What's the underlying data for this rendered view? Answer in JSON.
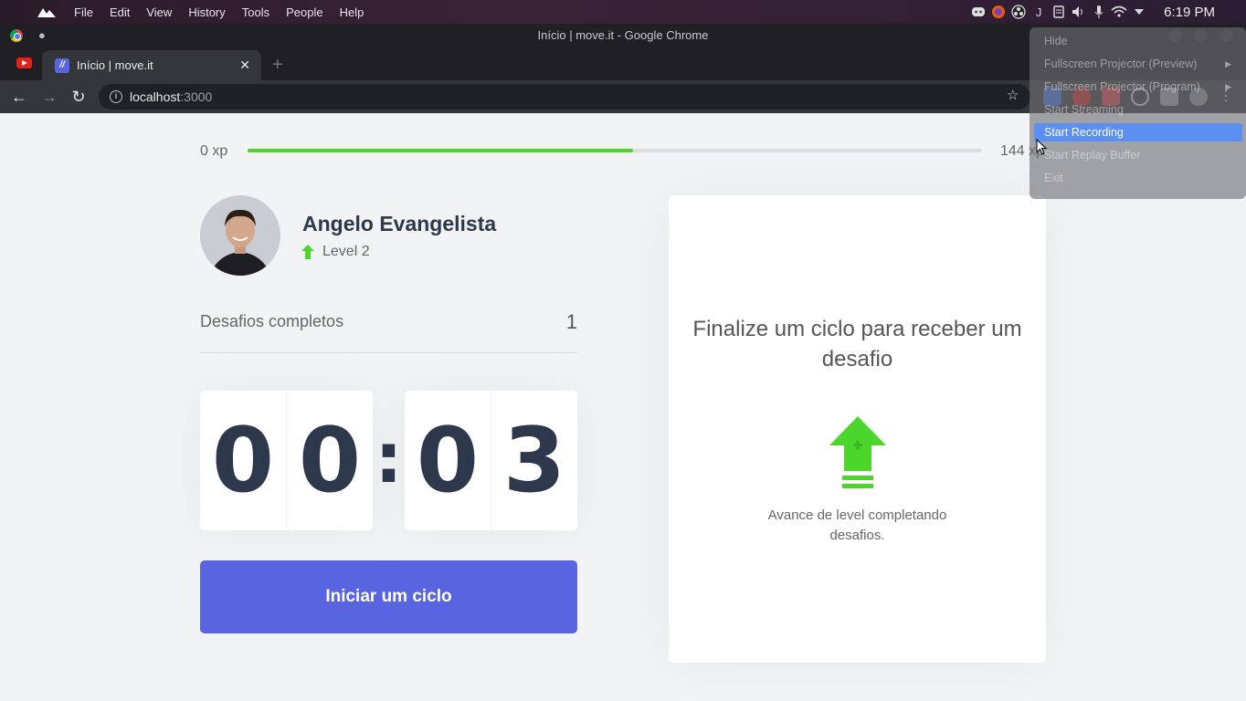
{
  "os_bar": {
    "menu": [
      "File",
      "Edit",
      "View",
      "History",
      "Tools",
      "People",
      "Help"
    ],
    "clock": "6:19 PM"
  },
  "window": {
    "title": "Início | move.it - Google Chrome"
  },
  "tabs": [
    {
      "label": "Início | move.it"
    }
  ],
  "address": {
    "host": "localhost",
    "port": ":3000"
  },
  "xp": {
    "min": "0 xp",
    "max": "144 xp",
    "progress_fraction": 0.525
  },
  "profile": {
    "name": "Angelo Evangelista",
    "level": "Level 2"
  },
  "challenges": {
    "label": "Desafios completos",
    "count": "1"
  },
  "timer": {
    "minute_left": "0",
    "minute_right": "0",
    "separator": ":",
    "second_left": "0",
    "second_right": "3"
  },
  "start_button": "Iniciar um ciclo",
  "challenge_card": {
    "title": "Finalize um ciclo para receber um desafio",
    "description": "Avance de level completando desafios."
  },
  "tray_menu": {
    "items": [
      "Hide",
      "Fullscreen Projector (Preview)",
      "Fullscreen Projector (Program)",
      "Start Streaming",
      "Start Recording",
      "Start Replay Buffer",
      "Exit"
    ],
    "highlighted": "Start Recording"
  },
  "colors": {
    "accent": "#5965e0",
    "progress": "#4cd62b",
    "title_text": "#2e384d"
  }
}
